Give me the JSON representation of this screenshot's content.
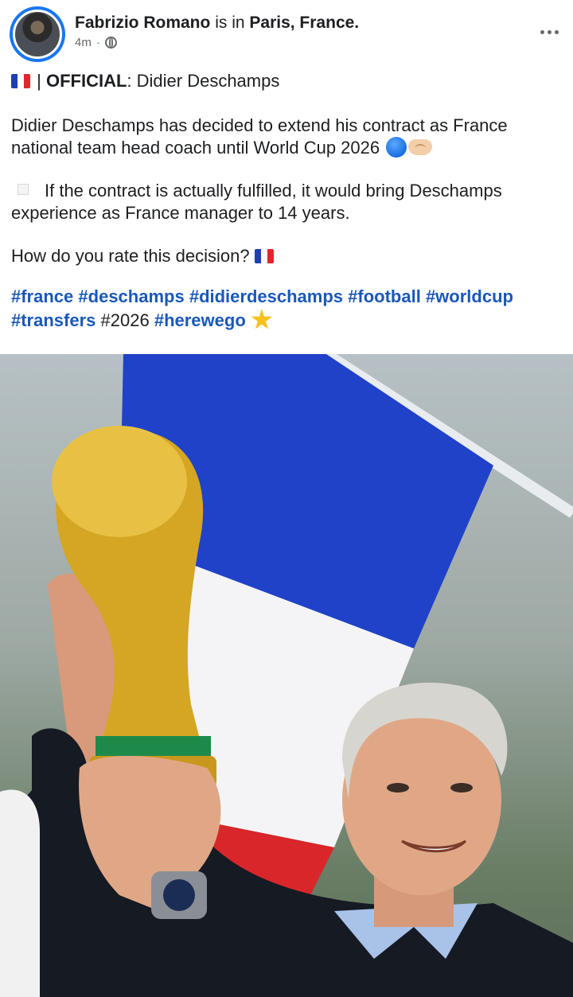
{
  "post": {
    "author": "Fabrizio Romano",
    "location_prefix": "is in",
    "location": "Paris, France.",
    "time": "4m",
    "separator": "·",
    "official_label": "OFFICIAL",
    "official_title": ": Didier Deschamps",
    "pipe": "|",
    "paragraph1": "Didier Deschamps has decided to extend his contract as France national team head coach until World Cup 2026",
    "paragraph2": "If the contract is actually fulfilled, it would bring Deschamps experience as France manager to 14 years.",
    "question": "How do you rate this decision?",
    "hashtags": [
      {
        "text": "#france",
        "link": true
      },
      {
        "text": "#deschamps",
        "link": true
      },
      {
        "text": "#didierdeschamps",
        "link": true
      },
      {
        "text": "#football",
        "link": true
      },
      {
        "text": "#worldcup",
        "link": true
      },
      {
        "text": "#transfers",
        "link": true
      },
      {
        "text": "#2026",
        "link": false
      },
      {
        "text": "#herewego",
        "link": true
      }
    ]
  },
  "icons": {
    "globe": "globe-icon",
    "more": "more-options-icon",
    "flag": "france-flag-icon",
    "circle": "blue-circle-icon",
    "handshake": "handshake-icon",
    "star": "star-icon"
  },
  "colors": {
    "hashtag": "#1a58b8",
    "avatar_ring": "#1877f2",
    "flag_blue": "#1f3fb0",
    "flag_red": "#e0262f"
  }
}
